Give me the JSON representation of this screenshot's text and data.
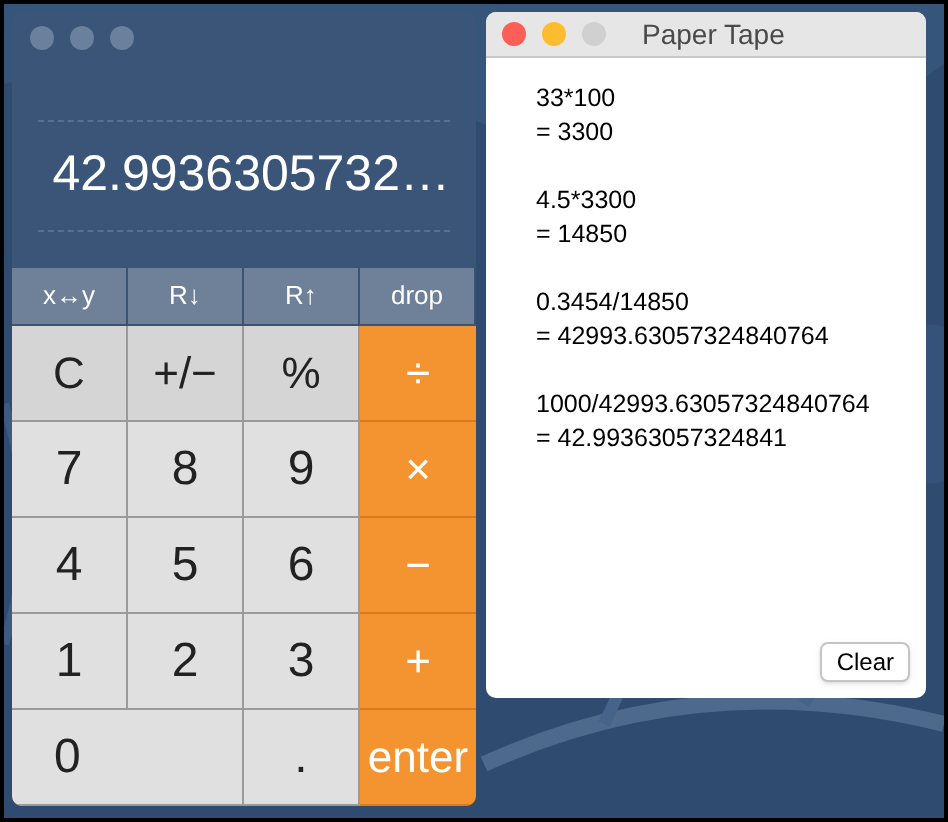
{
  "calculator": {
    "display": "42.9936305732…",
    "keys": [
      {
        "label": "x↔y",
        "kind": "fn",
        "wide": false
      },
      {
        "label": "R↓",
        "kind": "fn",
        "wide": false
      },
      {
        "label": "R↑",
        "kind": "fn",
        "wide": false
      },
      {
        "label": "drop",
        "kind": "fn",
        "wide": false
      },
      {
        "label": "C",
        "kind": "gray",
        "wide": false
      },
      {
        "label": "+/−",
        "kind": "gray",
        "wide": false
      },
      {
        "label": "%",
        "kind": "gray",
        "wide": false
      },
      {
        "label": "÷",
        "kind": "op",
        "wide": false
      },
      {
        "label": "7",
        "kind": "digit",
        "wide": false
      },
      {
        "label": "8",
        "kind": "digit",
        "wide": false
      },
      {
        "label": "9",
        "kind": "digit",
        "wide": false
      },
      {
        "label": "×",
        "kind": "op",
        "wide": false
      },
      {
        "label": "4",
        "kind": "digit",
        "wide": false
      },
      {
        "label": "5",
        "kind": "digit",
        "wide": false
      },
      {
        "label": "6",
        "kind": "digit",
        "wide": false
      },
      {
        "label": "−",
        "kind": "op",
        "wide": false
      },
      {
        "label": "1",
        "kind": "digit",
        "wide": false
      },
      {
        "label": "2",
        "kind": "digit",
        "wide": false
      },
      {
        "label": "3",
        "kind": "digit",
        "wide": false
      },
      {
        "label": "+",
        "kind": "op",
        "wide": false
      },
      {
        "label": "0",
        "kind": "digit",
        "wide": true
      },
      {
        "label": ".",
        "kind": "digit",
        "wide": false
      },
      {
        "label": "enter",
        "kind": "op",
        "wide": false
      }
    ]
  },
  "paper_tape": {
    "title": "Paper Tape",
    "entries": [
      {
        "expression": "33*100",
        "result": "= 3300"
      },
      {
        "expression": "4.5*3300",
        "result": "= 14850"
      },
      {
        "expression": "0.3454/14850",
        "result": "= 42993.63057324840764"
      },
      {
        "expression": "1000/42993.63057324840764",
        "result": "= 42.99363057324841"
      }
    ],
    "clear_button": "Clear"
  }
}
